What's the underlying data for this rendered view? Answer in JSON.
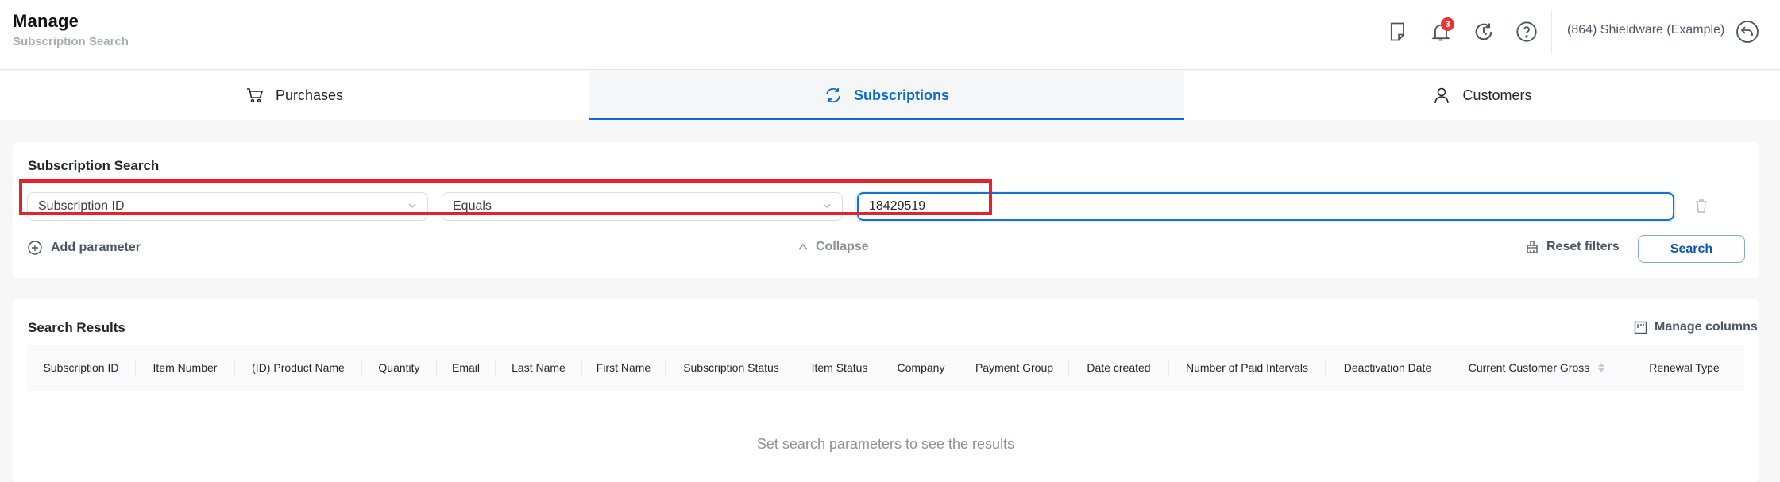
{
  "header": {
    "title": "Manage",
    "subtitle": "Subscription Search",
    "icons": [
      "notes-icon",
      "bell-icon",
      "history-icon",
      "help-icon"
    ],
    "notifications_count": "3",
    "account_label": "(864) Shieldware (Example)"
  },
  "tabs": [
    {
      "label": "Purchases",
      "icon": "cart-icon",
      "active": false
    },
    {
      "label": "Subscriptions",
      "icon": "refresh-icon",
      "active": true
    },
    {
      "label": "Customers",
      "icon": "user-icon",
      "active": false
    }
  ],
  "search": {
    "title": "Subscription Search",
    "field_select": "Subscription ID",
    "operator_select": "Equals",
    "value": "18429519",
    "add_parameter": "Add parameter",
    "collapse": "Collapse",
    "reset_filters": "Reset filters",
    "search_button": "Search"
  },
  "results": {
    "title": "Search Results",
    "manage_columns": "Manage columns",
    "columns": [
      "Subscription ID",
      "Item Number",
      "(ID) Product Name",
      "Quantity",
      "Email",
      "Last Name",
      "First Name",
      "Subscription Status",
      "Item Status",
      "Company",
      "Payment Group",
      "Date created",
      "Number of Paid Intervals",
      "Deactivation Date",
      "Current Customer Gross",
      "Renewal Type"
    ],
    "empty_message": "Set search parameters to see the results"
  },
  "colors": {
    "accent": "#0a6bc9",
    "highlight": "#e8202a",
    "badge": "#e8352e"
  }
}
